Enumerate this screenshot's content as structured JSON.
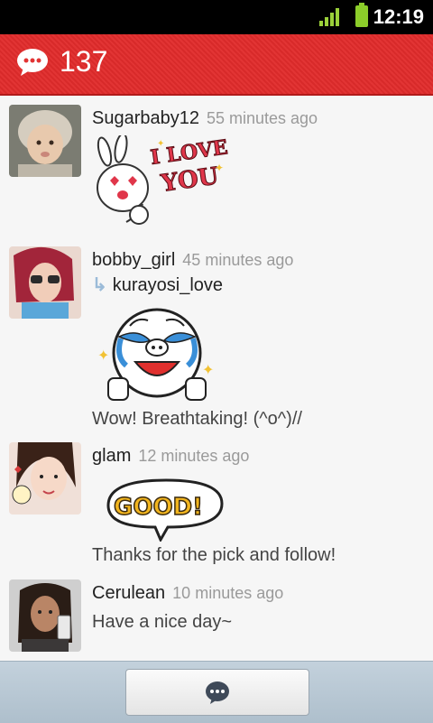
{
  "status": {
    "time": "12:19"
  },
  "header": {
    "count": "137",
    "icon": "speech-bubble-icon",
    "accent": "#e23434"
  },
  "posts": [
    {
      "user": "Sugarbaby12",
      "time": "55 minutes ago",
      "sticker": {
        "line1": "I LOVE",
        "line2": "YOU"
      }
    },
    {
      "user": "bobby_girl",
      "time": "45 minutes ago",
      "reply_to": "kurayosi_love",
      "text": "Wow! Breathtaking! (^o^)//"
    },
    {
      "user": "glam",
      "time": "12 minutes ago",
      "sticker": {
        "word": "GOOD!"
      },
      "text": "Thanks for the pick and follow!"
    },
    {
      "user": "Cerulean",
      "time": "10 minutes ago",
      "text": "Have a nice day~"
    }
  ],
  "bottom": {
    "compose_icon": "chat-bubble-icon"
  }
}
